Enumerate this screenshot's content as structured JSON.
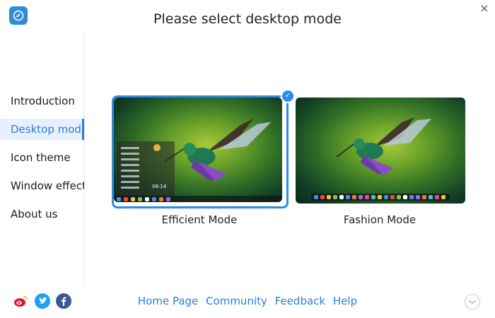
{
  "window": {
    "title": "Please select desktop mode",
    "close_glyph": "×"
  },
  "sidebar": {
    "items": [
      {
        "label": "Introduction",
        "active": false
      },
      {
        "label": "Desktop mode",
        "active": true
      },
      {
        "label": "Icon theme",
        "active": false
      },
      {
        "label": "Window effect",
        "active": false
      },
      {
        "label": "About us",
        "active": false
      }
    ]
  },
  "modes": [
    {
      "label": "Efficient Mode",
      "selected": true
    },
    {
      "label": "Fashion Mode",
      "selected": false
    }
  ],
  "thumbnail": {
    "clock": "08:14"
  },
  "footer": {
    "links": [
      "Home Page",
      "Community",
      "Feedback",
      "Help"
    ],
    "social_icons": [
      "weibo-icon",
      "twitter-icon",
      "facebook-icon"
    ]
  },
  "colors": {
    "accent": "#2b7dde",
    "weibo": "#e6162d",
    "twitter": "#1da1f2",
    "facebook": "#3b5998"
  }
}
